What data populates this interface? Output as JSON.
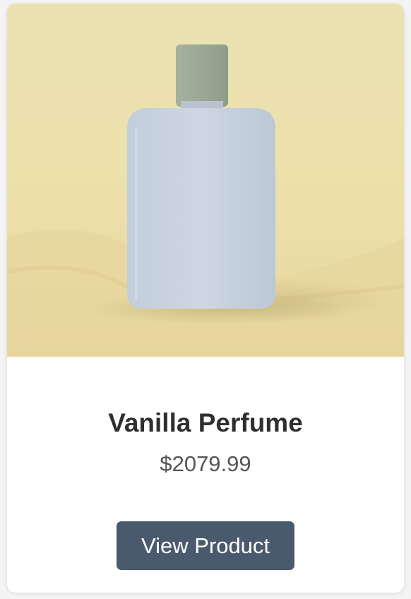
{
  "product": {
    "name": "Vanilla Perfume",
    "price": "$2079.99",
    "button_label": "View Product"
  },
  "colors": {
    "button_bg": "#4a5a6e",
    "image_bg": "#ece0ad",
    "bottle": "#c7d1dd",
    "cap": "#9ba895"
  }
}
